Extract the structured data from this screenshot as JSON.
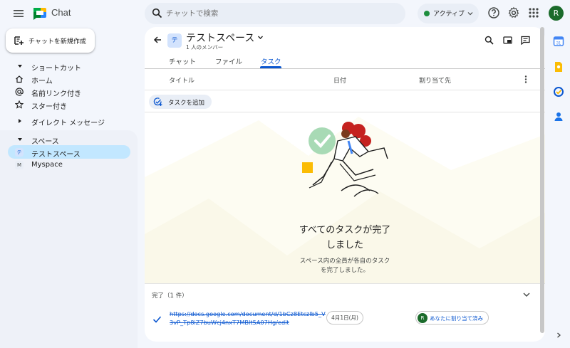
{
  "app": {
    "title": "Chat"
  },
  "search": {
    "placeholder": "チャットで検索"
  },
  "status": {
    "label": "アクティブ",
    "color": "#1e8e3e"
  },
  "user": {
    "initial": "R"
  },
  "sidebar": {
    "new_chat_label": "チャットを新規作成",
    "shortcuts_header": "ショートカット",
    "shortcuts": [
      {
        "label": "ホーム",
        "icon": "home-icon"
      },
      {
        "label": "名前リンク付き",
        "icon": "at-icon"
      },
      {
        "label": "スター付き",
        "icon": "star-icon"
      }
    ],
    "dm_header": "ダイレクト メッセージ",
    "spaces_header": "スペース",
    "spaces": [
      {
        "label": "テストスペース",
        "avatar": "テ",
        "selected": true
      },
      {
        "label": "Myspace",
        "avatar": "M",
        "selected": false
      }
    ]
  },
  "space": {
    "badge": "テ",
    "title": "テストスペース",
    "member_count": "1 人のメンバー"
  },
  "tabs": [
    {
      "label": "チャット",
      "active": false
    },
    {
      "label": "ファイル",
      "active": false
    },
    {
      "label": "タスク",
      "active": true
    }
  ],
  "tasks": {
    "columns": {
      "title": "タイトル",
      "date": "日付",
      "assignee": "割り当て先"
    },
    "add_label": "タスクを追加",
    "empty_title_line1": "すべてのタスクが完了",
    "empty_title_line2": "しました",
    "empty_sub_line1": "スペース内の全員が各自のタスク",
    "empty_sub_line2": "を完了しました。",
    "completed_label": "完了（1 件）",
    "completed_items": [
      {
        "title": "https://docs.google.com/document/d/1bCz8Etczlb5_V3vP_Tp8iZ7buWcj4nxT7MBIt5A07Hg/edit",
        "date": "4月1日(月)",
        "assignee_initial": "R",
        "assignee_label": "あなたに割り当て済み"
      }
    ]
  },
  "colors": {
    "accent": "#0b57d0",
    "selected": "#c2e7ff"
  }
}
